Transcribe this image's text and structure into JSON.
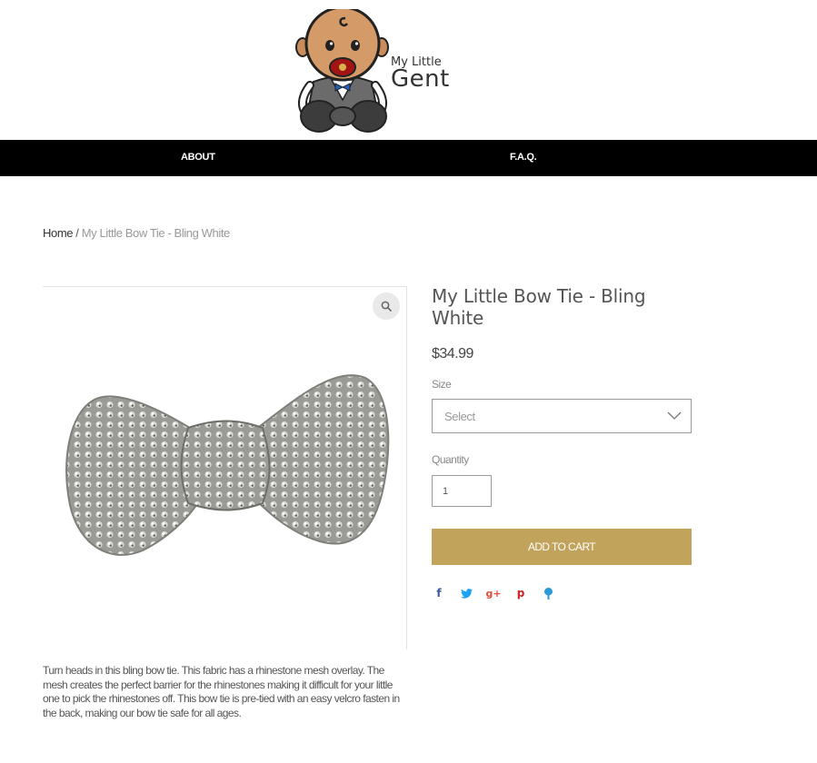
{
  "brand": {
    "line1": "My Little",
    "line2": "Gent"
  },
  "nav": {
    "about": "ABOUT",
    "faq": "F.A.Q."
  },
  "breadcrumb": {
    "home": "Home",
    "separator": "/",
    "current": "My Little Bow Tie - Bling White"
  },
  "product": {
    "title": "My Little Bow Tie - Bling White",
    "price": "$34.99",
    "size_label": "Size",
    "size_selected": "Select",
    "quantity_label": "Quantity",
    "quantity_value": "1",
    "add_to_cart": "ADD TO CART",
    "description": "Turn heads in this bling bow tie. This fabric has a rhinestone mesh overlay. The mesh creates the perfect barrier for the rhinestones making it difficult for your little one to pick the rhinestones off. This bow tie is pre-tied with an easy velcro fasten in the back, making our bow tie safe for all ages."
  },
  "social": [
    {
      "name": "facebook",
      "glyph": "f"
    },
    {
      "name": "twitter",
      "glyph": "t"
    },
    {
      "name": "google-plus",
      "glyph": "g+"
    },
    {
      "name": "pinterest",
      "glyph": "p"
    },
    {
      "name": "fancy",
      "glyph": "F"
    }
  ],
  "colors": {
    "accent": "#c1a35b",
    "navbar": "#000000",
    "text": "#555555"
  }
}
